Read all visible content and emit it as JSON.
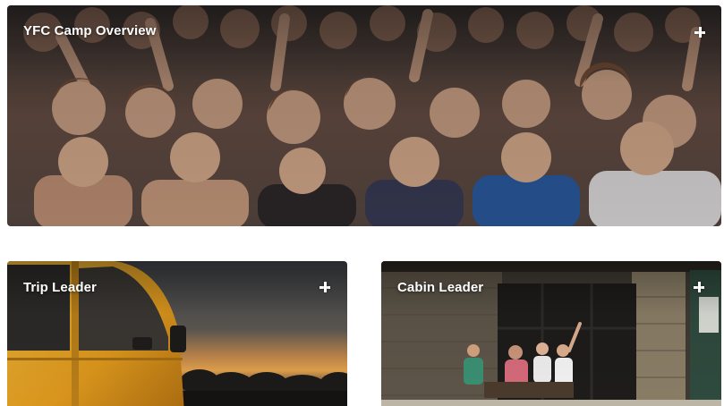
{
  "cards": [
    {
      "title": "YFC Camp Overview",
      "icon": "plus-icon",
      "image": "crowd of cheering campers"
    },
    {
      "title": "Trip Leader",
      "icon": "plus-icon",
      "image": "yellow van at sunset by the ocean"
    },
    {
      "title": "Cabin Leader",
      "icon": "plus-icon",
      "image": "campers posing in front of a cabin"
    }
  ]
}
